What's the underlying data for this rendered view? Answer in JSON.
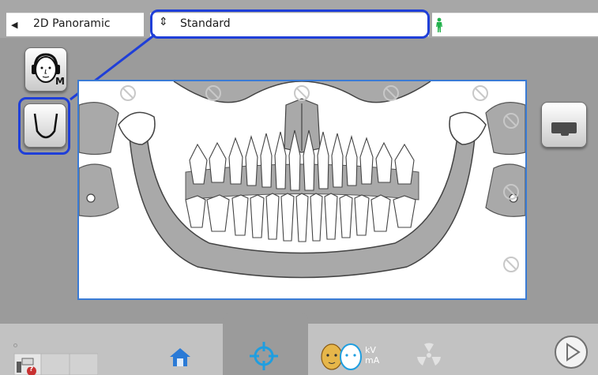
{
  "topbar": {
    "exam_type": "2D Panoramic",
    "exam_type_arrow": "◀",
    "profile": "Standard",
    "profile_arrow": "⇕",
    "patient_icon": "person-standing-icon"
  },
  "side_buttons": {
    "head_icon": "head-headphones-icon",
    "head_badge": "M",
    "arch_icon": "dental-arch-icon",
    "bite_icon": "bite-block-icon"
  },
  "xray": {
    "image": "panoramic-dental-diagram",
    "disabled_markers": "prohibited-sign-icon"
  },
  "bottombar": {
    "help_icon": "patient-help-icon",
    "help_badge": "?",
    "home_icon": "home-icon",
    "positioning_icon": "crosshair-target-icon",
    "kv_label": "kV",
    "ma_label": "mA",
    "radiation_icon": "radiation-icon",
    "next_icon": "play-next-icon"
  },
  "colors": {
    "highlight": "#1f3fd8",
    "frame": "#3a7bd5",
    "accent_green": "#22b14c"
  }
}
